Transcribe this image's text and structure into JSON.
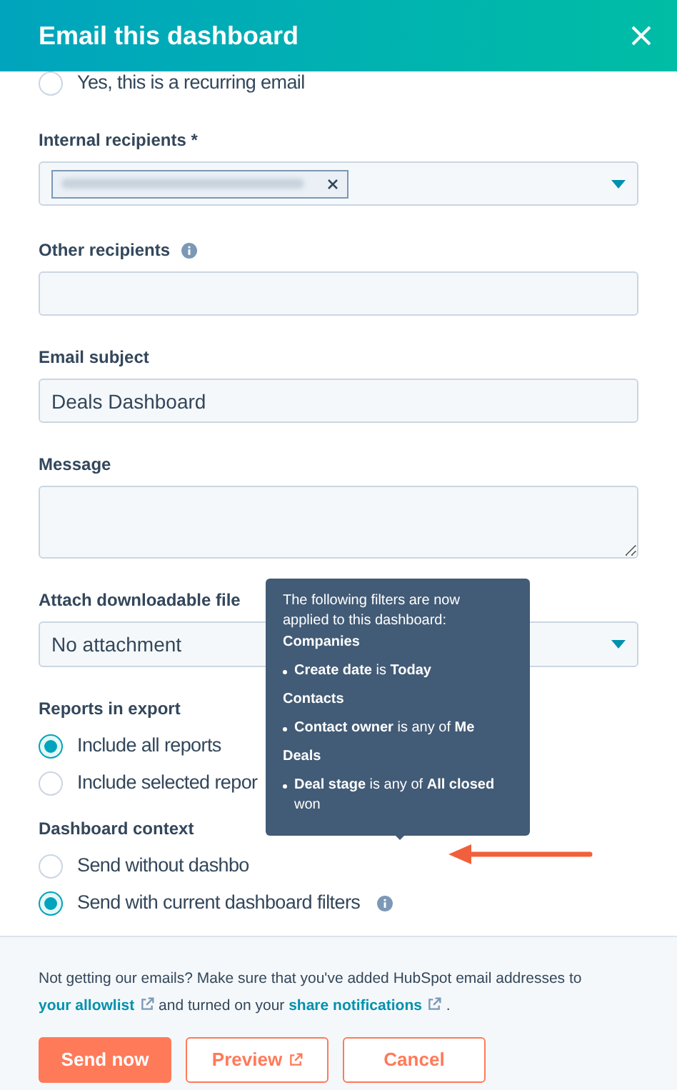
{
  "dialog": {
    "title": "Email this dashboard"
  },
  "recurring": {
    "label": "Yes, this is a recurring email",
    "selected": false
  },
  "internal_recipients": {
    "label": "Internal recipients *"
  },
  "other_recipients": {
    "label": "Other recipients"
  },
  "email_subject": {
    "label": "Email subject",
    "value": "Deals Dashboard"
  },
  "message": {
    "label": "Message"
  },
  "attachment": {
    "label": "Attach downloadable file",
    "value": "No attachment"
  },
  "radio_groups": [
    {
      "label": "Reports in export",
      "options": [
        {
          "label": "Include all reports",
          "selected": true
        },
        {
          "label": "Include selected repor",
          "selected": false
        }
      ]
    },
    {
      "label": "Dashboard context",
      "options": [
        {
          "label": "Send without dashbo",
          "selected": false
        },
        {
          "label": "Send with current dashboard filters",
          "selected": true,
          "info": true
        }
      ]
    }
  ],
  "tooltip": {
    "intro": "The following filters are now applied to this dashboard:",
    "sections": [
      {
        "heading": "Companies",
        "items": [
          "**Create date** is **Today**"
        ]
      },
      {
        "heading": "Contacts",
        "items": [
          "**Contact owner** is any of **Me**"
        ]
      },
      {
        "heading": "Deals",
        "items": [
          "**Deal stage** is any of **All closed** won"
        ]
      }
    ]
  },
  "footer": {
    "note_before": "Not getting our emails? Make sure that you've added HubSpot email addresses to",
    "link_1": "your allowlist",
    "note_middle": "and turned on your",
    "link_2": "share notifications",
    "note_end": ".",
    "buttons": [
      {
        "label": "Send now",
        "kind": "primary"
      },
      {
        "label": "Preview",
        "kind": "secondary",
        "external": true
      },
      {
        "label": "Cancel",
        "kind": "secondary"
      }
    ]
  }
}
